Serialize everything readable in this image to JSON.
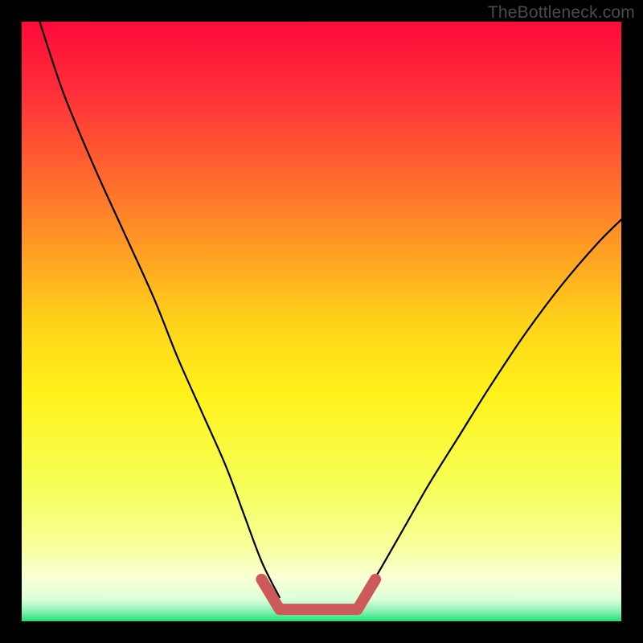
{
  "watermark": "TheBottleneck.com",
  "gradient": {
    "stops": [
      {
        "offset": 0.0,
        "color": "#ff0a3a"
      },
      {
        "offset": 0.12,
        "color": "#ff2f3a"
      },
      {
        "offset": 0.3,
        "color": "#ff7a2a"
      },
      {
        "offset": 0.5,
        "color": "#ffd21a"
      },
      {
        "offset": 0.62,
        "color": "#fff21a"
      },
      {
        "offset": 0.78,
        "color": "#f6ff5a"
      },
      {
        "offset": 0.88,
        "color": "#f8ffa0"
      },
      {
        "offset": 0.93,
        "color": "#faffd8"
      },
      {
        "offset": 0.965,
        "color": "#d8ffd8"
      },
      {
        "offset": 0.985,
        "color": "#80f0b0"
      },
      {
        "offset": 1.0,
        "color": "#20e070"
      }
    ]
  },
  "chart_data": {
    "type": "line",
    "title": "",
    "xlabel": "",
    "ylabel": "",
    "xlim": [
      0,
      100
    ],
    "ylim": [
      0,
      100
    ],
    "series": [
      {
        "name": "curve-left",
        "x": [
          3,
          7,
          12,
          17,
          22,
          26,
          30,
          34,
          37,
          40,
          43
        ],
        "values": [
          100,
          88,
          76,
          65,
          54,
          44,
          35,
          26,
          18,
          10,
          4
        ]
      },
      {
        "name": "curve-right",
        "x": [
          57,
          60,
          64,
          68,
          73,
          78,
          84,
          90,
          96,
          100
        ],
        "values": [
          4,
          9,
          16,
          23,
          31,
          39,
          48,
          56,
          63,
          67
        ]
      }
    ],
    "highlight": {
      "name": "bottom-bracket",
      "color": "#cc5a5a",
      "x": [
        40,
        43,
        56,
        59
      ],
      "values": [
        7,
        2,
        2,
        7
      ]
    }
  }
}
